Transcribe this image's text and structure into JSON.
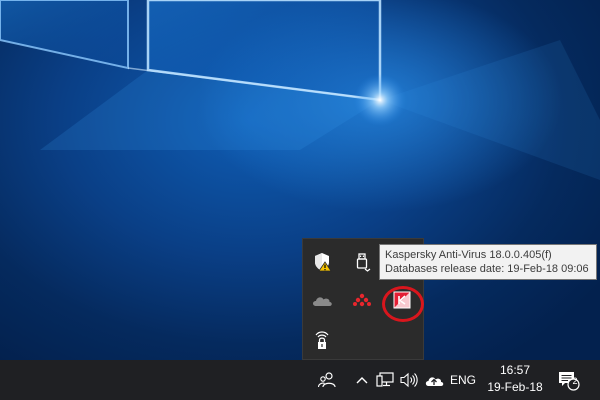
{
  "tooltip": {
    "line1": "Kaspersky Anti-Virus 18.0.0.405(f)",
    "line2": "Databases release date: 19-Feb-18 09:06"
  },
  "tray_icons": [
    {
      "name": "windows-defender-warning-icon"
    },
    {
      "name": "usb-eject-icon"
    },
    {
      "name": "onedrive-cloud-icon"
    },
    {
      "name": "red-dots-app-icon"
    },
    {
      "name": "kaspersky-icon"
    },
    {
      "name": "vpn-lock-icon"
    }
  ],
  "taskbar": {
    "language": "ENG",
    "time": "16:57",
    "date": "19-Feb-18",
    "notification_count": "2"
  },
  "colors": {
    "taskbar_bg": "#1f2023",
    "tray_popup_bg": "#2b2b2b",
    "highlight_ring": "#d9161d",
    "desktop_blue": "#0a3f86"
  }
}
